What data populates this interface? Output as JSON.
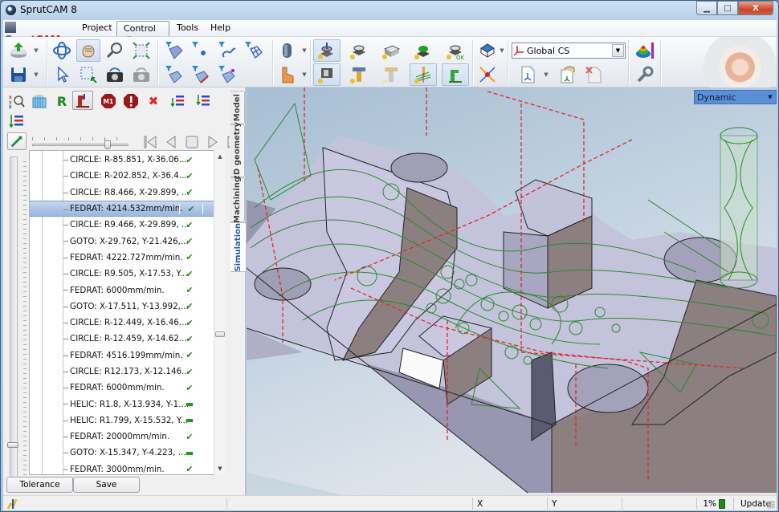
{
  "window": {
    "title": "SprutCAM 8",
    "controls": {
      "minimize": "▭",
      "maximize": "□",
      "close": "X"
    }
  },
  "menubar": {
    "logo": {
      "part1": "Sprut",
      "part2": "CAM"
    },
    "items": [
      {
        "label": "Project",
        "active": false
      },
      {
        "label": "Control",
        "active": true,
        "pin": "ᖗ"
      },
      {
        "label": "Tools",
        "active": false
      },
      {
        "label": "Help",
        "active": false
      }
    ]
  },
  "toolbar": {
    "groups": [
      {
        "name": "file",
        "buttons": [
          "import-icon",
          "save-icon"
        ]
      },
      {
        "name": "view",
        "buttons": [
          "rotate-view-icon",
          "pan-hand-icon",
          "zoom-icon",
          "fit-all-icon",
          "select-arrow-icon",
          "zoom-window-icon",
          "snapshot-icon",
          "snapshot-disabled-icon"
        ]
      },
      {
        "name": "filters",
        "buttons": [
          "filter-solids-icon",
          "filter-points-icon",
          "filter-curves-icon",
          "filter-meshes-icon",
          "filter-surfaces-icon",
          "filter-surface-edges-icon",
          "filter-surface-points-icon"
        ]
      },
      {
        "name": "objects",
        "buttons": [
          "workpiece-icon",
          "fixture-icon"
        ]
      },
      {
        "name": "operations",
        "buttons": [
          "part-setup-icon",
          "part-icon",
          "stock-icon",
          "fixture-green-icon",
          "part-ok-icon",
          "machine-vise-icon",
          "tool-icon",
          "tool-disabled-icon",
          "toolpath-icon",
          "machine-icon"
        ]
      },
      {
        "name": "coordinate",
        "buttons": [
          "wireframe-cube-icon",
          "snap-point-icon"
        ]
      },
      {
        "name": "cs",
        "buttons": [
          "cs-new-icon",
          "cs-edit-icon",
          "cs-delete-icon"
        ]
      },
      {
        "name": "analysis",
        "buttons": [
          "color-map-icon",
          "settings-wrench-icon"
        ]
      }
    ],
    "cs_combo": {
      "value": "Global CS"
    }
  },
  "left_panel": {
    "toolbar_buttons": [
      {
        "name": "xyz-inspect-icon"
      },
      {
        "name": "stock-model-icon"
      },
      {
        "name": "reset-r-icon",
        "label": "R"
      },
      {
        "name": "machine-view-icon",
        "pressed": true
      },
      {
        "name": "m1-stop-icon",
        "label": "M1"
      },
      {
        "name": "alert-stop-icon",
        "label": "!"
      },
      {
        "name": "clear-x-icon",
        "label": "✖"
      },
      {
        "name": "list-down-icon"
      },
      {
        "name": "list-collapse-icon"
      },
      {
        "name": "list-expand-icon"
      }
    ],
    "playback": {
      "speed_fraction": 0.78,
      "buttons": [
        "first-icon",
        "back-icon",
        "stop-icon",
        "forward-icon",
        "last-icon"
      ]
    },
    "list_position_fraction": 0.88,
    "commands": [
      {
        "text": "CIRCLE: R-85.851, X-36.06...",
        "status": "ok"
      },
      {
        "text": "CIRCLE: R-202.852, X-36.4...",
        "status": "ok"
      },
      {
        "text": "CIRCLE: R8.466, X-29.899, ...",
        "status": "ok"
      },
      {
        "text": "FEDRAT: 4214.532mm/min.",
        "status": "ok",
        "selected": true
      },
      {
        "text": "CIRCLE: R9.466, X-29.899, ...",
        "status": "ok"
      },
      {
        "text": "GOTO: X-29.762, Y-21.426,...",
        "status": "ok"
      },
      {
        "text": "FEDRAT: 4222.727mm/min.",
        "status": "ok"
      },
      {
        "text": "CIRCLE: R9.505, X-17.53, Y...",
        "status": "ok"
      },
      {
        "text": "FEDRAT: 6000mm/min.",
        "status": "ok"
      },
      {
        "text": "GOTO: X-17.511, Y-13.992,...",
        "status": "ok"
      },
      {
        "text": "CIRCLE: R-12.449, X-16.46...",
        "status": "ok"
      },
      {
        "text": "CIRCLE: R-12.459, X-14.62...",
        "status": "ok"
      },
      {
        "text": "FEDRAT: 4516.199mm/min.",
        "status": "ok"
      },
      {
        "text": "CIRCLE: R12.173, X-12.146...",
        "status": "ok"
      },
      {
        "text": "FEDRAT: 6000mm/min.",
        "status": "ok"
      },
      {
        "text": "HELIC: R1.8, X-13.934, Y-1....",
        "status": "pending"
      },
      {
        "text": "HELIC: R1.799, X-15.532, Y...",
        "status": "pending"
      },
      {
        "text": "FEDRAT: 20000mm/min.",
        "status": "ok"
      },
      {
        "text": "GOTO: X-15.347, Y-4.223, ...",
        "status": "pending"
      },
      {
        "text": "FEDRAT: 3000mm/min.",
        "status": "ok"
      }
    ],
    "status_glyphs": {
      "ok": "✔",
      "pending": "▬"
    },
    "buttons": {
      "tolerance": "Tolerance",
      "save": "Save"
    }
  },
  "side_tabs": [
    {
      "label": "Model",
      "active": false
    },
    {
      "label": "2D geometry",
      "active": false
    },
    {
      "label": "Machining",
      "active": false
    },
    {
      "label": "Simulation",
      "active": true
    }
  ],
  "viewport": {
    "view_mode": "Dynamic",
    "colors": {
      "toolpath": "#2a8a2a",
      "rapid": "#e02828",
      "part_top": "#c3c3dc",
      "part_side": "#9a9ab2",
      "part_wall": "#8a7c7c"
    }
  },
  "statusbar": {
    "x_label": "X",
    "y_label": "Y",
    "progress_percent": "1%",
    "update_label": "Update"
  }
}
